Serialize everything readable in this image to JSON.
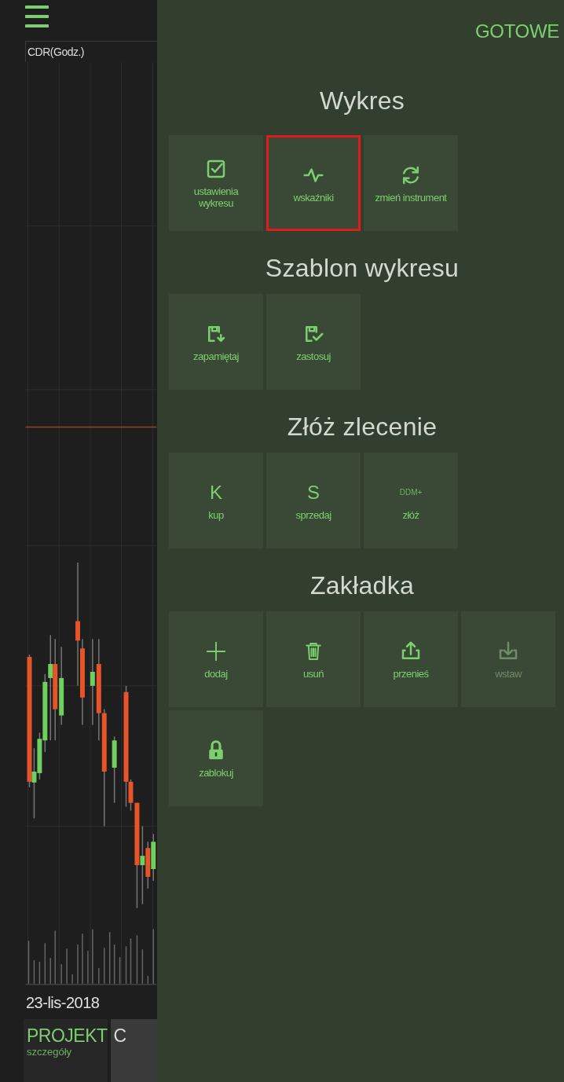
{
  "chart": {
    "title": "CDR(Godz.)",
    "date": "23-lis-2018"
  },
  "tabs": [
    {
      "label": "PROJEKT",
      "sublabel": "szczegóły",
      "selected": true
    },
    {
      "label": "C",
      "selected": false
    }
  ],
  "panel": {
    "done": "GOTOWE",
    "sections": [
      {
        "title": "Wykres",
        "items": [
          {
            "kind": "icon",
            "label": "ustawienia wykresu",
            "highlighted": false,
            "disabled": false
          },
          {
            "kind": "icon",
            "label": "wskaźniki",
            "highlighted": true,
            "disabled": false
          },
          {
            "kind": "icon",
            "label": "zmień instrument",
            "highlighted": false,
            "disabled": false
          }
        ]
      },
      {
        "title": "Szablon wykresu",
        "items": [
          {
            "kind": "icon",
            "label": "zapamiętaj",
            "highlighted": false,
            "disabled": false
          },
          {
            "kind": "icon",
            "label": "zastosuj",
            "highlighted": false,
            "disabled": false
          }
        ]
      },
      {
        "title": "Złóż zlecenie",
        "items": [
          {
            "kind": "letter",
            "symbol": "K",
            "label": "kup",
            "highlighted": false,
            "disabled": false
          },
          {
            "kind": "letter",
            "symbol": "S",
            "label": "sprzedaj",
            "highlighted": false,
            "disabled": false
          },
          {
            "kind": "badge",
            "symbol": "DDM+",
            "label": "złóż",
            "highlighted": false,
            "disabled": false
          }
        ]
      },
      {
        "title": "Zakładka",
        "items": [
          {
            "kind": "icon",
            "label": "dodaj",
            "highlighted": false,
            "disabled": false
          },
          {
            "kind": "icon",
            "label": "usuń",
            "highlighted": false,
            "disabled": false
          },
          {
            "kind": "icon",
            "label": "przenieś",
            "highlighted": false,
            "disabled": false
          },
          {
            "kind": "icon",
            "label": "wstaw",
            "highlighted": false,
            "disabled": true
          },
          {
            "kind": "icon",
            "label": "zablokuj",
            "highlighted": false,
            "disabled": false
          }
        ]
      }
    ]
  }
}
